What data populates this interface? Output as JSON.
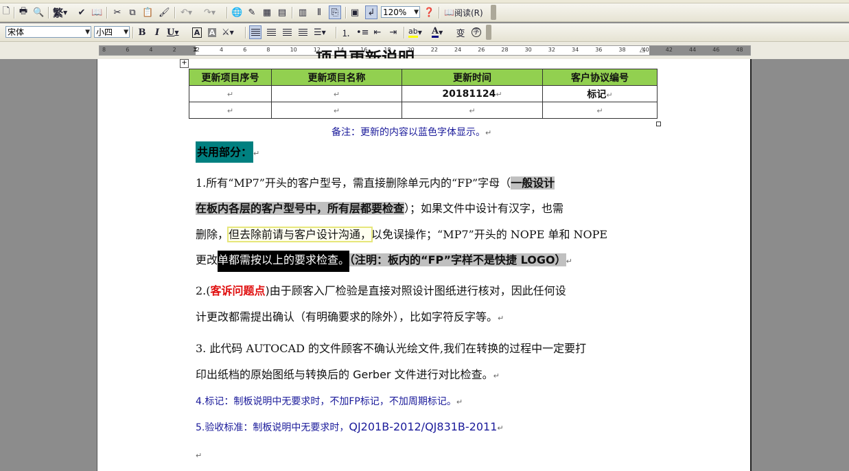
{
  "toolbar": {
    "zoom_value": "120%",
    "reading_label": "阅读(R)",
    "traditional_label": "繁",
    "font_name": "宋体",
    "font_size": "小四",
    "bold_label": "B",
    "italic_label": "I",
    "underline_label": "U",
    "char_border_label": "A",
    "char_shade_label": "A",
    "font_color_label": "A",
    "phonetic_label": "变",
    "enclose_label": "字"
  },
  "ruler": {
    "ticks": [
      "8",
      "6",
      "4",
      "2",
      "2",
      "4",
      "6",
      "8",
      "10",
      "12",
      "14",
      "16",
      "18",
      "20",
      "22",
      "24",
      "26",
      "28",
      "30",
      "32",
      "34",
      "36",
      "38",
      "40",
      "42",
      "44",
      "46",
      "48"
    ]
  },
  "document": {
    "title": "项目更新说明",
    "table": {
      "headers": [
        "更新项目序号",
        "更新项目名称",
        "更新时间",
        "客户协议编号"
      ],
      "rows": [
        [
          "",
          "",
          "20181124",
          "标记"
        ],
        [
          "",
          "",
          "",
          ""
        ]
      ]
    },
    "note": "备注：更新的内容以蓝色字体显示。",
    "section_heading": "共用部分：",
    "p1": {
      "l1a": "1.所有“MP7”开头的客户型号，需直接删除单元内的“FP”字母（",
      "l1b": "一般设计",
      "l2a": "在板内各层的客户型号中，所有层都要检查",
      "l2b": "）；如果文件中设计有汉字，也需",
      "l3a": "删除，",
      "l3b": "但去除前请与客户设计沟通，",
      "l3c": "以免误操作；“MP7”开头的 NOPE 单和 NOPE",
      "l4a": "更改",
      "l4b": "单都需按以上的要求检查。",
      "l4c": "（注明：板内的“FP”字样不是快捷 LOGO）"
    },
    "p2": {
      "l1a": "2.(",
      "l1b": "客诉问题点",
      "l1c": ")由于顾客入厂检验是直接对照设计图纸进行核对，因此任何设",
      "l2": "计更改都需提出确认（有明确要求的除外），比如字符反字等。"
    },
    "p3": {
      "l1": "3. 此代码 AUTOCAD 的文件顾客不确认光绘文件,我们在转换的过程中一定要打",
      "l2": "印出纸档的原始图纸与转换后的 Gerber 文件进行对比检查。"
    },
    "p4": "4.标记：制板说明中无要求时，不加FP标记，不加周期标记。",
    "p5a": "5.验收标准：制板说明中无要求时，",
    "p5b": "QJ201B-2012/QJ831B-2011",
    "paragraph_mark": "↵"
  }
}
